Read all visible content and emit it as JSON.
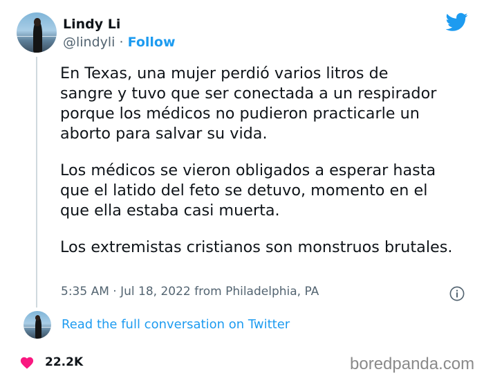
{
  "author": {
    "name": "Lindy Li",
    "handle": "@lindyli",
    "separator": "·",
    "follow_label": "Follow"
  },
  "tweet": {
    "paragraphs": [
      [
        "En Texas, una mujer perdió varios litros de",
        "sangre y tuvo que ser conectada a un respirador",
        "porque los médicos no pudieron practicarle un",
        "aborto para salvar su vida."
      ],
      [
        "Los médicos se vieron obligados a esperar hasta",
        "que el latido del feto se detuvo, momento en el",
        "que ella estaba casi muerta."
      ],
      [
        "Los extremistas cristianos son monstruos brutales."
      ]
    ],
    "timestamp": "5:35 AM · Jul 18, 2022 from Philadelphia, PA"
  },
  "conversation_link": "Read the full conversation on Twitter",
  "likes": "22.2K",
  "watermark": "boredpanda.com",
  "icons": {
    "brand": "twitter-bird-icon",
    "info": "info-icon",
    "like": "heart-icon"
  },
  "colors": {
    "accent": "#1d9bf0",
    "heart": "#f91880",
    "muted": "#536471",
    "text": "#0f1419"
  }
}
